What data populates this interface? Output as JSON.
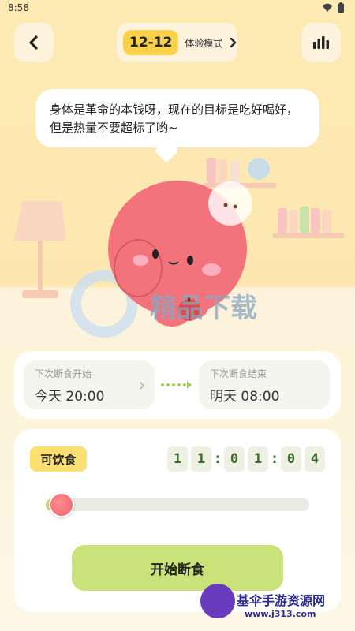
{
  "status_bar": {
    "time": "8:58"
  },
  "header": {
    "mode_badge": "12-12",
    "mode_label": "体验模式"
  },
  "speech": {
    "text": "身体是革命的本钱呀，现在的目标是吃好喝好，但是热量不要超标了哟~"
  },
  "schedule": {
    "start": {
      "label": "下次断食开始",
      "value": "今天 20:00"
    },
    "end": {
      "label": "下次断食结束",
      "value": "明天 08:00"
    }
  },
  "timer": {
    "status": "可饮食",
    "digits": [
      "1",
      "1",
      "0",
      "1",
      "0",
      "4"
    ],
    "progress_fraction": 0.03
  },
  "actions": {
    "start_label": "开始断食"
  },
  "watermark": {
    "center": "精品下载",
    "site_name": "基伞手游资源网",
    "site_url": "www.j313.com"
  },
  "colors": {
    "background": "#fdeab3",
    "accent_yellow": "#f9d24a",
    "accent_green": "#c9e27a",
    "character_pink": "#f2737c"
  },
  "icons": [
    "back-arrow-icon",
    "chevron-right-icon",
    "bar-chart-icon",
    "dotted-arrow-icon"
  ]
}
